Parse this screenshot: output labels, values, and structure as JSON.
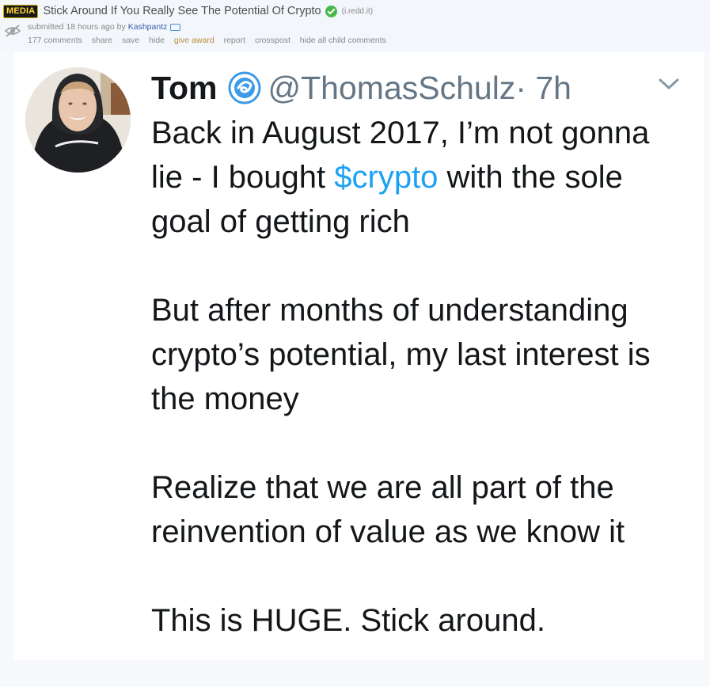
{
  "post": {
    "flair": "MEDIA",
    "title": "Stick Around If You Really See The Potential Of Crypto",
    "domain": "(i.redd.it)",
    "submitted": "submitted 18 hours ago by",
    "author": "Kashpantz",
    "buttons": {
      "comments": "177 comments",
      "share": "share",
      "save": "save",
      "hide": "hide",
      "give_award": "give award",
      "report": "report",
      "crosspost": "crosspost",
      "hide_children": "hide all child comments"
    }
  },
  "tweet": {
    "display_name": "Tom",
    "handle": "@ThomasSchulz",
    "time": " · 7h",
    "p1_a": "Back in August 2017, I’m not gonna lie - I bought ",
    "p1_cashtag": "$crypto",
    "p1_b": " with the sole goal of getting rich",
    "p2": "But after months of understanding crypto’s potential, my last interest is the money",
    "p3": "Realize that we are all part of the reinvention of value as we know it",
    "p4": "This is HUGE. Stick around."
  },
  "colors": {
    "link_blue": "#1da1f2",
    "verified_green": "#46b947",
    "handle_gray": "#657786"
  },
  "icons": [
    "hidden-eye-icon",
    "verified-check-icon",
    "moderator-icon",
    "verified-badge-icon",
    "chevron-down-icon"
  ]
}
